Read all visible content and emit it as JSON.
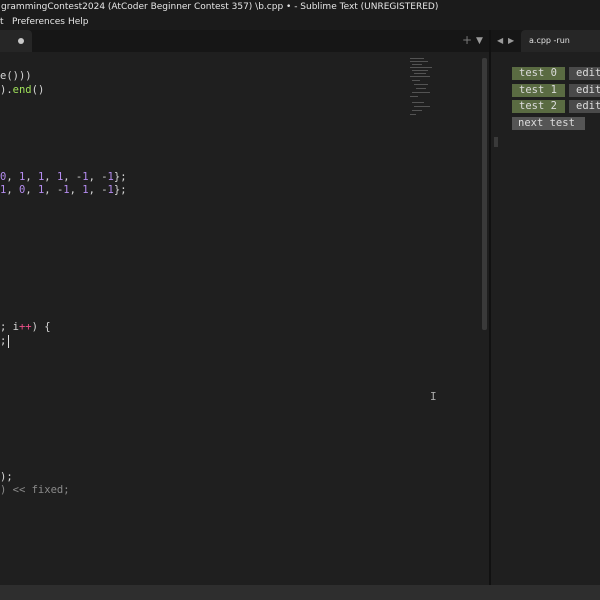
{
  "window": {
    "title": "grammingContest2024  (AtCoder Beginner Contest 357)  \\b.cpp • - Sublime Text (UNREGISTERED)"
  },
  "menu": {
    "items": [
      "t",
      "Preferences",
      "Help"
    ]
  },
  "editor_tab": {
    "dirty": true
  },
  "right_tab": {
    "label": "a.cpp -run"
  },
  "code_lines": [
    [
      {
        "t": "e()))",
        "c": "#d6d6d6"
      }
    ],
    [
      {
        "t": ").end()",
        "c": "#d6d6d6"
      }
    ],
    [
      {
        "t": "0, 1, 1, 1, -1, -1};",
        "c": "#d6d6d6"
      }
    ],
    [
      {
        "t": "1, 0, 1, -1, 1, -1};",
        "c": "#d6d6d6"
      }
    ],
    [
      {
        "t": "; i++) {",
        "c": "#d6d6d6"
      }
    ],
    [
      {
        "t": ";",
        "c": "#d6d6d6"
      }
    ],
    [
      {
        "t": ");",
        "c": "#d6d6d6"
      }
    ],
    [
      {
        "t": ") << fixed;",
        "c": "#8a8a8a"
      }
    ]
  ],
  "run_panel": {
    "tests": [
      {
        "label": "test 0",
        "edit": "edit"
      },
      {
        "label": "test 1",
        "edit": "edit"
      },
      {
        "label": "test 2",
        "edit": "edit"
      }
    ],
    "next_label": "next test"
  },
  "colors": {
    "number": "#b58cf0",
    "keyword": "#e8e8e8",
    "operator": "#f0508a",
    "function": "#9fe05a",
    "comment": "#8a8a8a",
    "test_button": "#5a6b42",
    "edit_button": "#4a4a4a"
  },
  "icons": [
    "plus-icon",
    "chevron-down-icon",
    "nav-left-icon",
    "nav-right-icon",
    "text-cursor-icon"
  ]
}
